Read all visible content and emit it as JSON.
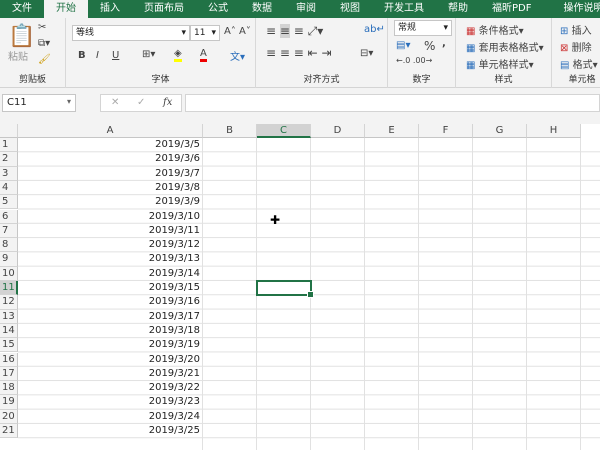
{
  "tabs": [
    "文件",
    "开始",
    "插入",
    "页面布局",
    "公式",
    "数据",
    "审阅",
    "视图",
    "开发工具",
    "帮助",
    "福昕PDF",
    "操作说明搜索"
  ],
  "ribbon": {
    "clipboard": {
      "label": "剪贴板",
      "paste": "粘贴"
    },
    "font": {
      "label": "字体",
      "name": "等线",
      "size": "11",
      "bold": "B",
      "italic": "I",
      "underline": "U"
    },
    "align": {
      "label": "对齐方式"
    },
    "number": {
      "label": "数字",
      "format": "常规",
      "percent": "%",
      "comma": ","
    },
    "styles": {
      "label": "样式",
      "cond": "条件格式",
      "table": "套用表格格式",
      "cell": "单元格样式"
    },
    "cells": {
      "label": "单元格",
      "insert": "插入",
      "delete": "删除",
      "format": "格式"
    }
  },
  "formula_bar": {
    "name_box": "C11",
    "fx": "fx",
    "value": ""
  },
  "columns": [
    "A",
    "B",
    "C",
    "D",
    "E",
    "F",
    "G",
    "H"
  ],
  "selected_cell": "C11",
  "rows": [
    "2019/3/5",
    "2019/3/6",
    "2019/3/7",
    "2019/3/8",
    "2019/3/9",
    "2019/3/10",
    "2019/3/11",
    "2019/3/12",
    "2019/3/13",
    "2019/3/14",
    "2019/3/15",
    "2019/3/16",
    "2019/3/17",
    "2019/3/18",
    "2019/3/19",
    "2019/3/20",
    "2019/3/21",
    "2019/3/22",
    "2019/3/23",
    "2019/3/24",
    "2019/3/25"
  ]
}
